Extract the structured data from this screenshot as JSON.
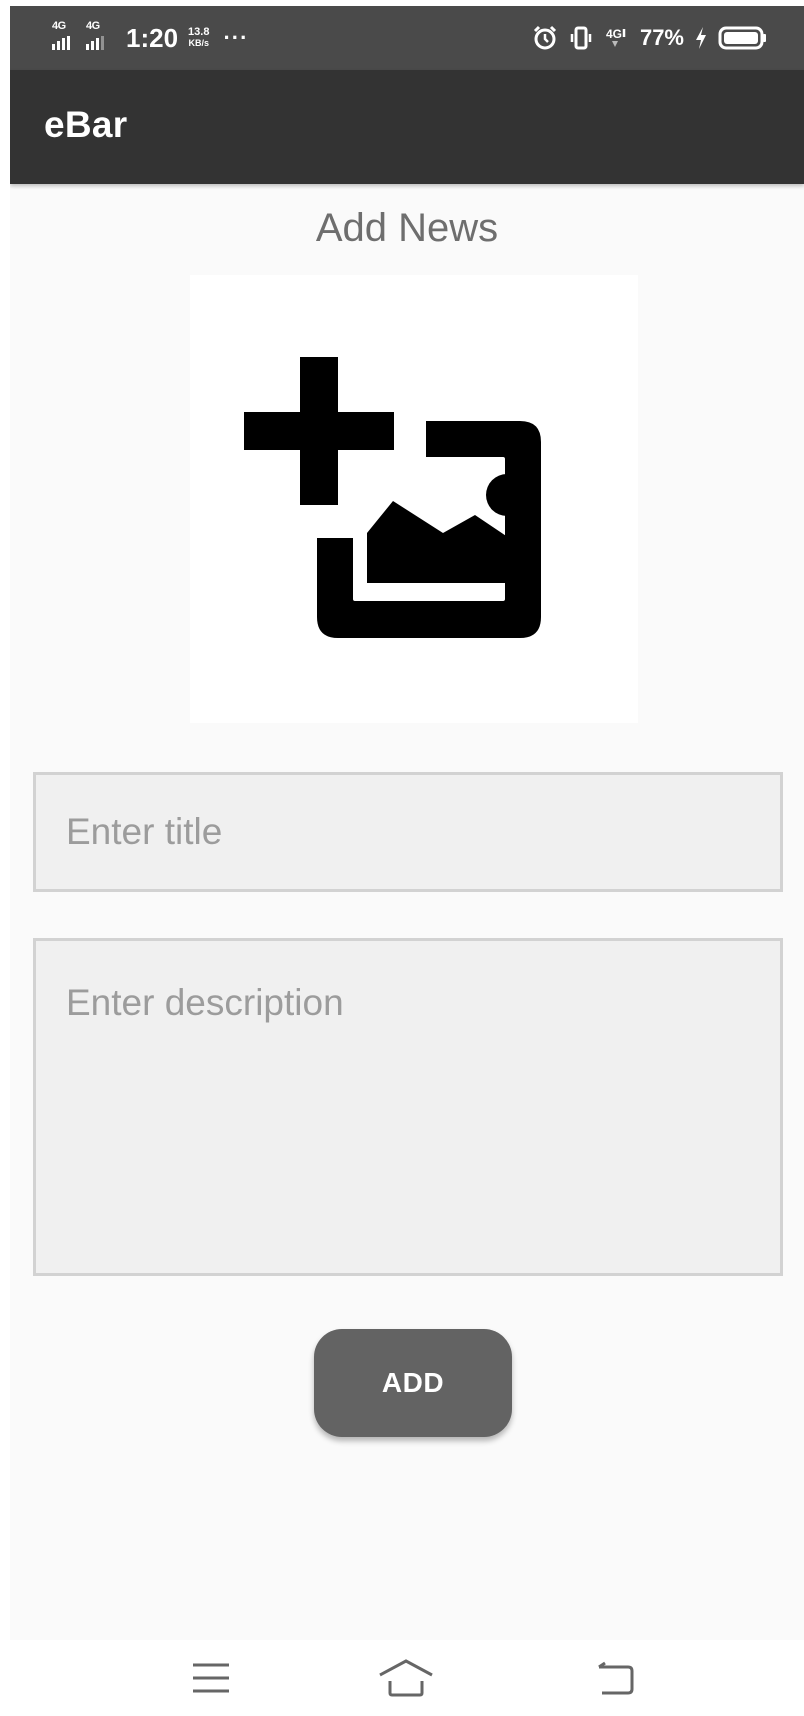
{
  "status_bar": {
    "network_1": "4G",
    "network_2": "4G",
    "time": "1:20",
    "speed_value": "13.8",
    "speed_unit": "KB/s",
    "more": "···",
    "network_3": "4G",
    "battery_percent": "77%",
    "icons": [
      "signal-icon",
      "signal-icon",
      "alarm-icon",
      "vibrate-icon",
      "data-icon",
      "charging-icon",
      "battery-icon"
    ]
  },
  "app_bar": {
    "title": "eBar"
  },
  "main": {
    "heading": "Add News",
    "image_picker_icon": "add-photo-icon",
    "title_placeholder": "Enter title",
    "description_placeholder": "Enter description",
    "add_label": "ADD"
  },
  "nav_bar": {
    "icons": [
      "menu-icon",
      "home-icon",
      "back-icon"
    ]
  },
  "colors": {
    "status_bar_bg": "#4a4a4a",
    "app_bar_bg": "#333333",
    "page_bg": "#fafafa",
    "field_bg": "#f0f0f0",
    "field_border": "#d2d2d2",
    "button_bg": "#636363",
    "placeholder_text": "#9c9c9c",
    "heading_text": "#6e6e6e"
  }
}
